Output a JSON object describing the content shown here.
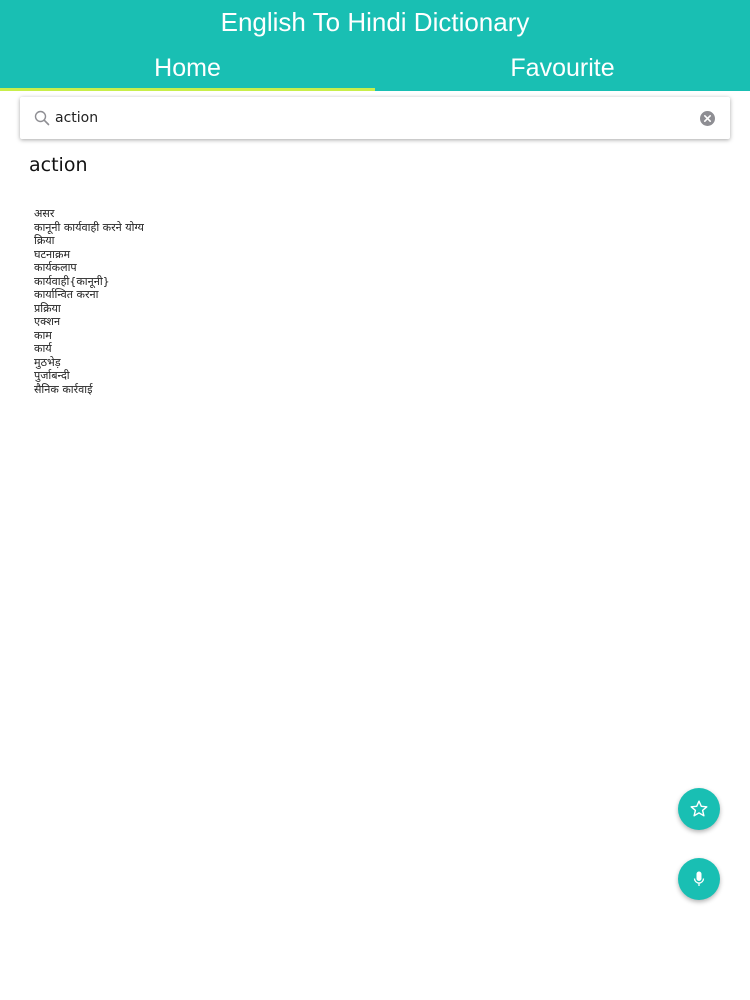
{
  "header": {
    "title": "English To Hindi Dictionary"
  },
  "tabs": [
    {
      "label": "Home",
      "active": true
    },
    {
      "label": "Favourite",
      "active": false
    }
  ],
  "search": {
    "value": "action",
    "placeholder": "",
    "icon": "search-icon",
    "clear_icon": "clear-icon"
  },
  "result": {
    "word": "action",
    "meanings": [
      "असर",
      "कानूनी कार्यवाही करने योग्य",
      "क्रिया",
      "घटनाक्रम",
      "कार्यकलाप",
      "कार्यवाही{कानूनी}",
      "कार्यान्वित करना",
      "प्रक्रिया",
      "एक्शन",
      "काम",
      "कार्य",
      "मुठभेड़",
      "पुर्जाबन्दी",
      "सैनिक कार्रवाई"
    ]
  },
  "fabs": {
    "favourite_icon": "star-icon",
    "mic_icon": "microphone-icon"
  },
  "colors": {
    "accent": "#19bfb3",
    "tab_indicator": "#c8ee4a"
  }
}
